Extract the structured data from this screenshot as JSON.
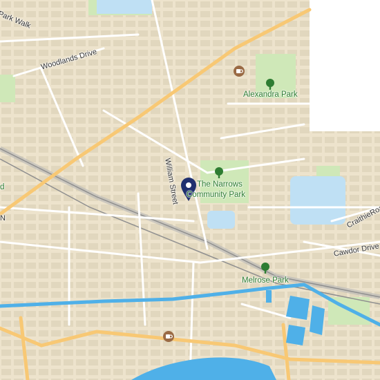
{
  "map": {
    "colors": {
      "land": "#ede3cc",
      "block": "#d9cfb6",
      "road_minor": "#ffffff",
      "road_major": "#f8c874",
      "park": "#cfe8b8",
      "water": "#4fb0e8",
      "water_light": "#bfe0f4",
      "rail": "#b5b5b5",
      "pin": "#1f2f6f"
    },
    "labels": {
      "park_walk": "Park Walk",
      "woodlands_drive": "Woodlands Drive",
      "william_street": "William Street",
      "alexandra_park": "Alexandra Park",
      "narrows_line1": "The Narrows",
      "narrows_line2": "Community Park",
      "craithie_road": "CraithieRoad",
      "cawdor_drive": "Cawdor Drive",
      "melrose_park": "Melrose Park",
      "edge_d": "d",
      "edge_n": "N"
    },
    "icons": {
      "pin": "location-pin-icon",
      "park": "tree-icon",
      "cafe": "coffee-cup-icon"
    }
  }
}
